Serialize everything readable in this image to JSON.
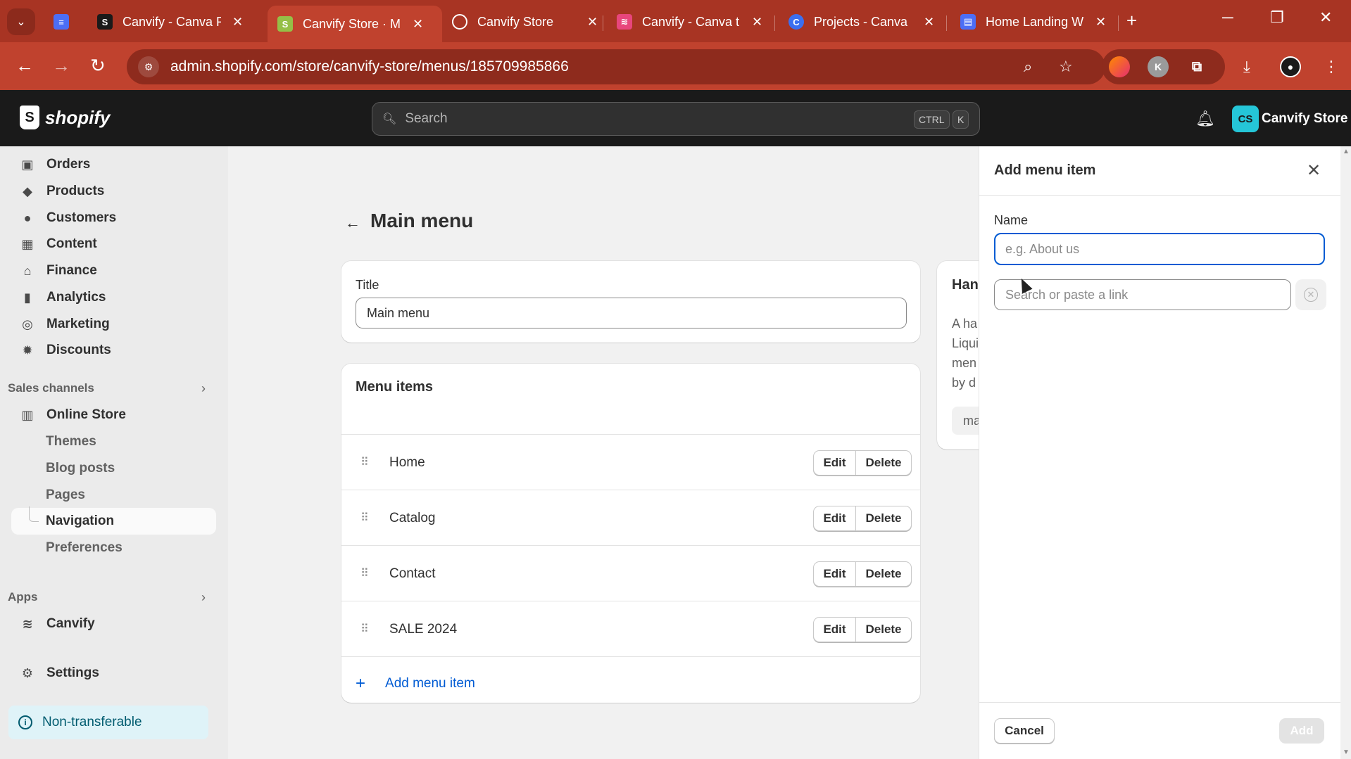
{
  "browser": {
    "tabs": [
      {
        "label": "",
        "icon": "docs-icon"
      },
      {
        "label": "Canvify - Canva P",
        "icon": "shopify-icon"
      },
      {
        "label": "Canvify Store · M",
        "icon": "shopify-icon",
        "active": true
      },
      {
        "label": "Canvify Store",
        "icon": "globe-icon"
      },
      {
        "label": "Canvify - Canva t",
        "icon": "canvify-icon"
      },
      {
        "label": "Projects - Canva",
        "icon": "canva-icon"
      },
      {
        "label": "Home Landing W",
        "icon": "site-icon"
      }
    ],
    "url": "admin.shopify.com/store/canvify-store/menus/185709985866",
    "profile_initial": "K"
  },
  "topbar": {
    "logo_text": "shopify",
    "search_placeholder": "Search",
    "shortcut_1": "CTRL",
    "shortcut_2": "K",
    "store_initials": "CS",
    "store_name": "Canvify Store"
  },
  "sidebar": {
    "items": [
      {
        "label": "Orders",
        "icon": "orders-icon"
      },
      {
        "label": "Products",
        "icon": "tag-icon"
      },
      {
        "label": "Customers",
        "icon": "person-icon"
      },
      {
        "label": "Content",
        "icon": "content-icon"
      },
      {
        "label": "Finance",
        "icon": "bank-icon"
      },
      {
        "label": "Analytics",
        "icon": "bar-chart-icon"
      },
      {
        "label": "Marketing",
        "icon": "target-icon"
      },
      {
        "label": "Discounts",
        "icon": "discount-icon"
      }
    ],
    "sales_channels_heading": "Sales channels",
    "online_store": "Online Store",
    "sub_items": [
      "Themes",
      "Blog posts",
      "Pages",
      "Navigation",
      "Preferences"
    ],
    "apps_heading": "Apps",
    "app_canvify": "Canvify",
    "settings": "Settings",
    "non_transferable": "Non-transferable"
  },
  "main": {
    "page_title": "Main menu",
    "title_label": "Title",
    "title_value": "Main menu",
    "menu_items_heading": "Menu items",
    "menu_items": [
      {
        "label": "Home"
      },
      {
        "label": "Catalog"
      },
      {
        "label": "Contact"
      },
      {
        "label": "SALE 2024"
      }
    ],
    "edit_label": "Edit",
    "delete_label": "Delete",
    "add_menu_item": "Add menu item",
    "handle_partial": {
      "heading": "Han",
      "lines": [
        "A ha",
        "Liqui",
        "men",
        "by d"
      ],
      "chip": "ma"
    }
  },
  "panel": {
    "title": "Add menu item",
    "name_label": "Name",
    "name_placeholder": "e.g. About us",
    "link_placeholder": "Search or paste a link",
    "cancel_label": "Cancel",
    "add_label": "Add"
  },
  "colors": {
    "browser_tabbar": "#a83423",
    "browser_toolbar": "#c0422e",
    "shopify_topbar": "#1a1a1a",
    "link_blue": "#005bd3",
    "focus_blue": "#005bd3"
  }
}
